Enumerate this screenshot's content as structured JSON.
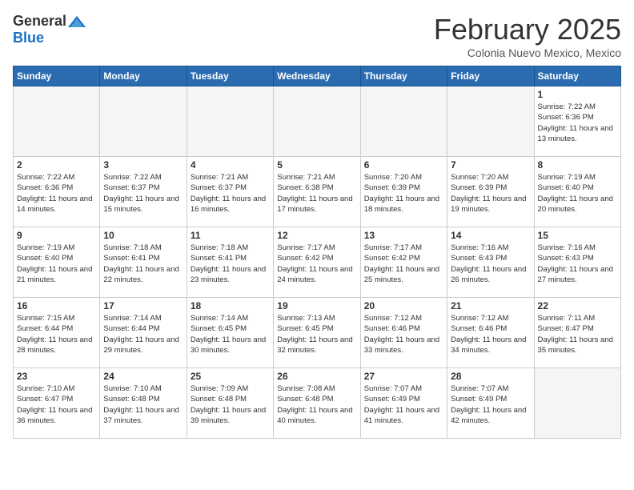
{
  "header": {
    "logo_general": "General",
    "logo_blue": "Blue",
    "title": "February 2025",
    "location": "Colonia Nuevo Mexico, Mexico"
  },
  "weekdays": [
    "Sunday",
    "Monday",
    "Tuesday",
    "Wednesday",
    "Thursday",
    "Friday",
    "Saturday"
  ],
  "weeks": [
    [
      {
        "day": "",
        "empty": true
      },
      {
        "day": "",
        "empty": true
      },
      {
        "day": "",
        "empty": true
      },
      {
        "day": "",
        "empty": true
      },
      {
        "day": "",
        "empty": true
      },
      {
        "day": "",
        "empty": true
      },
      {
        "day": "1",
        "sunrise": "7:22 AM",
        "sunset": "6:36 PM",
        "daylight": "11 hours and 13 minutes."
      }
    ],
    [
      {
        "day": "2",
        "sunrise": "7:22 AM",
        "sunset": "6:36 PM",
        "daylight": "11 hours and 14 minutes."
      },
      {
        "day": "3",
        "sunrise": "7:22 AM",
        "sunset": "6:37 PM",
        "daylight": "11 hours and 15 minutes."
      },
      {
        "day": "4",
        "sunrise": "7:21 AM",
        "sunset": "6:37 PM",
        "daylight": "11 hours and 16 minutes."
      },
      {
        "day": "5",
        "sunrise": "7:21 AM",
        "sunset": "6:38 PM",
        "daylight": "11 hours and 17 minutes."
      },
      {
        "day": "6",
        "sunrise": "7:20 AM",
        "sunset": "6:39 PM",
        "daylight": "11 hours and 18 minutes."
      },
      {
        "day": "7",
        "sunrise": "7:20 AM",
        "sunset": "6:39 PM",
        "daylight": "11 hours and 19 minutes."
      },
      {
        "day": "8",
        "sunrise": "7:19 AM",
        "sunset": "6:40 PM",
        "daylight": "11 hours and 20 minutes."
      }
    ],
    [
      {
        "day": "9",
        "sunrise": "7:19 AM",
        "sunset": "6:40 PM",
        "daylight": "11 hours and 21 minutes."
      },
      {
        "day": "10",
        "sunrise": "7:18 AM",
        "sunset": "6:41 PM",
        "daylight": "11 hours and 22 minutes."
      },
      {
        "day": "11",
        "sunrise": "7:18 AM",
        "sunset": "6:41 PM",
        "daylight": "11 hours and 23 minutes."
      },
      {
        "day": "12",
        "sunrise": "7:17 AM",
        "sunset": "6:42 PM",
        "daylight": "11 hours and 24 minutes."
      },
      {
        "day": "13",
        "sunrise": "7:17 AM",
        "sunset": "6:42 PM",
        "daylight": "11 hours and 25 minutes."
      },
      {
        "day": "14",
        "sunrise": "7:16 AM",
        "sunset": "6:43 PM",
        "daylight": "11 hours and 26 minutes."
      },
      {
        "day": "15",
        "sunrise": "7:16 AM",
        "sunset": "6:43 PM",
        "daylight": "11 hours and 27 minutes."
      }
    ],
    [
      {
        "day": "16",
        "sunrise": "7:15 AM",
        "sunset": "6:44 PM",
        "daylight": "11 hours and 28 minutes."
      },
      {
        "day": "17",
        "sunrise": "7:14 AM",
        "sunset": "6:44 PM",
        "daylight": "11 hours and 29 minutes."
      },
      {
        "day": "18",
        "sunrise": "7:14 AM",
        "sunset": "6:45 PM",
        "daylight": "11 hours and 30 minutes."
      },
      {
        "day": "19",
        "sunrise": "7:13 AM",
        "sunset": "6:45 PM",
        "daylight": "11 hours and 32 minutes."
      },
      {
        "day": "20",
        "sunrise": "7:12 AM",
        "sunset": "6:46 PM",
        "daylight": "11 hours and 33 minutes."
      },
      {
        "day": "21",
        "sunrise": "7:12 AM",
        "sunset": "6:46 PM",
        "daylight": "11 hours and 34 minutes."
      },
      {
        "day": "22",
        "sunrise": "7:11 AM",
        "sunset": "6:47 PM",
        "daylight": "11 hours and 35 minutes."
      }
    ],
    [
      {
        "day": "23",
        "sunrise": "7:10 AM",
        "sunset": "6:47 PM",
        "daylight": "11 hours and 36 minutes."
      },
      {
        "day": "24",
        "sunrise": "7:10 AM",
        "sunset": "6:48 PM",
        "daylight": "11 hours and 37 minutes."
      },
      {
        "day": "25",
        "sunrise": "7:09 AM",
        "sunset": "6:48 PM",
        "daylight": "11 hours and 39 minutes."
      },
      {
        "day": "26",
        "sunrise": "7:08 AM",
        "sunset": "6:48 PM",
        "daylight": "11 hours and 40 minutes."
      },
      {
        "day": "27",
        "sunrise": "7:07 AM",
        "sunset": "6:49 PM",
        "daylight": "11 hours and 41 minutes."
      },
      {
        "day": "28",
        "sunrise": "7:07 AM",
        "sunset": "6:49 PM",
        "daylight": "11 hours and 42 minutes."
      },
      {
        "day": "",
        "empty": true
      }
    ]
  ]
}
